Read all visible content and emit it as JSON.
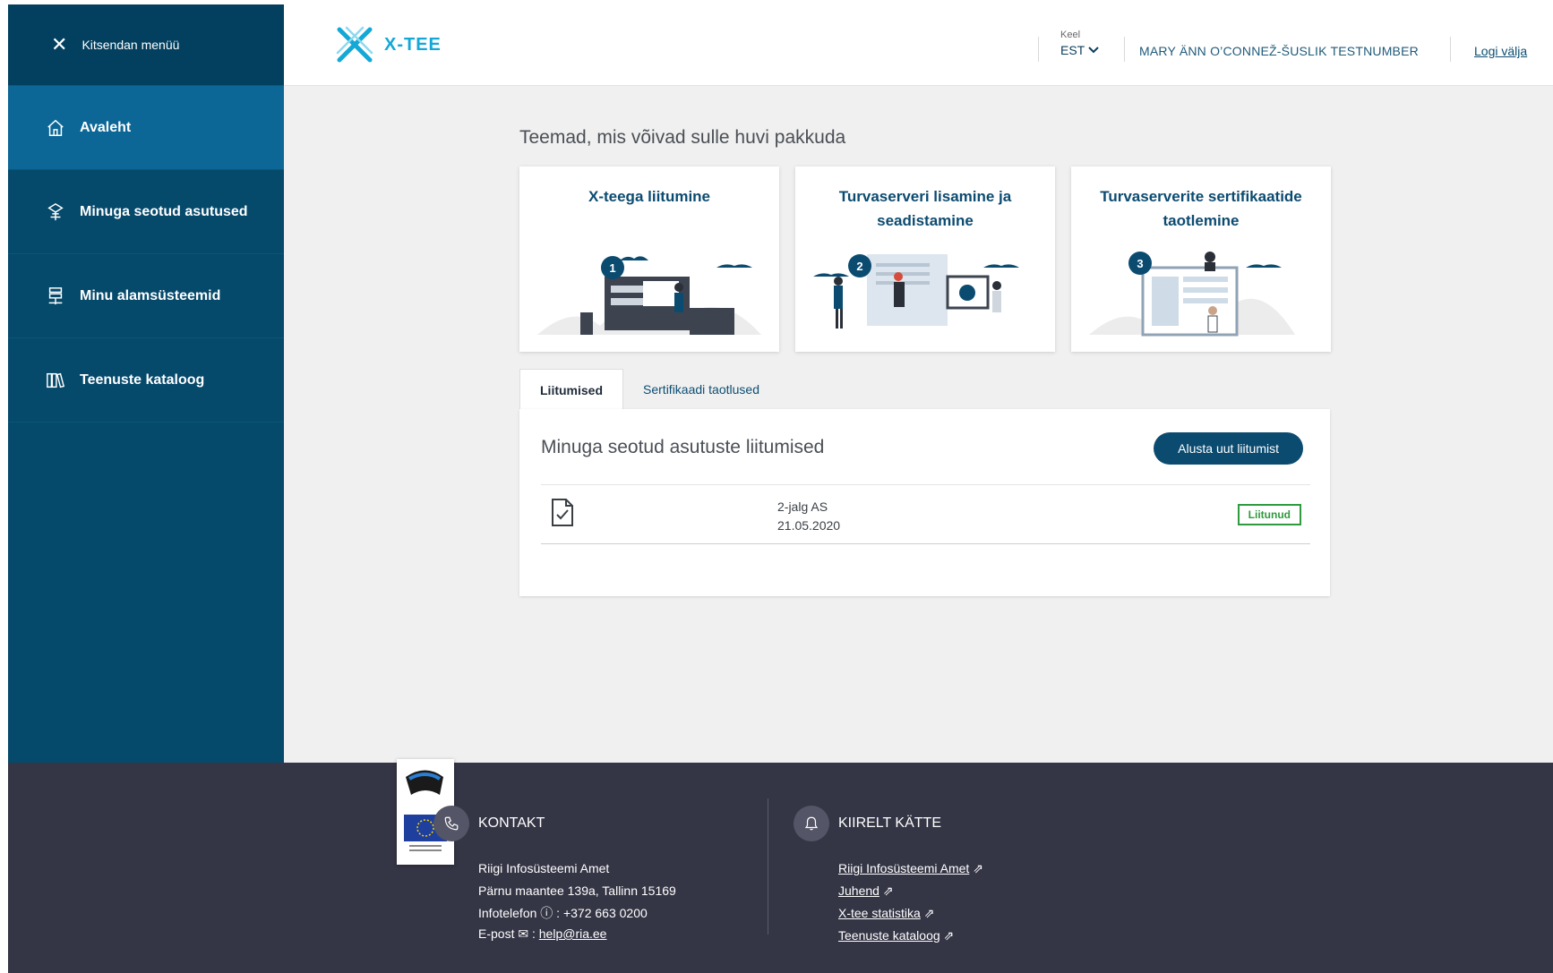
{
  "sidebar": {
    "collapse_label": "Kitsendan menüü",
    "items": [
      {
        "label": "Avaleht",
        "icon": "home-icon",
        "active": true
      },
      {
        "label": "Minuga seotud asutused",
        "icon": "organization-icon",
        "active": false
      },
      {
        "label": "Minu alamsüsteemid",
        "icon": "subsystem-icon",
        "active": false
      },
      {
        "label": "Teenuste kataloog",
        "icon": "catalog-icon",
        "active": false
      }
    ]
  },
  "header": {
    "logo_text": "X-TEE",
    "lang_label": "Keel",
    "lang_value": "EST",
    "user_name": "MARY ÄNN O’CONNEŽ-ŠUSLIK TESTNUMBER",
    "logout_label": "Logi välja"
  },
  "topics": {
    "title": "Teemad, mis võivad sulle huvi pakkuda",
    "cards": [
      {
        "title": "X-teega liitumine",
        "step": "1"
      },
      {
        "title": "Turvaserveri lisamine ja seadistamine",
        "step": "2"
      },
      {
        "title": "Turvaserverite sertifikaatide taotlemine",
        "step": "3"
      }
    ]
  },
  "tabs": [
    {
      "label": "Liitumised",
      "active": true
    },
    {
      "label": "Sertifikaadi taotlused",
      "active": false
    }
  ],
  "panel": {
    "title": "Minuga seotud asutuste liitumised",
    "new_button": "Alusta uut liitumist",
    "rows": [
      {
        "org": "2-jalg AS",
        "date": "21.05.2020",
        "status": "Liitunud"
      }
    ]
  },
  "footer": {
    "contact": {
      "heading": "KONTAKT",
      "org": "Riigi Infosüsteemi Amet",
      "address": "Pärnu maantee 139a, Tallinn 15169",
      "phone_label": "Infotelefon",
      "phone": "+372 663 0200",
      "email_label": "E-post",
      "email": "help@ria.ee"
    },
    "quick": {
      "heading": "KIIRELT KÄTTE",
      "links": [
        "Riigi Infosüsteemi Amet",
        "Juhend",
        "X-tee statistika",
        "Teenuste kataloog"
      ]
    }
  },
  "colors": {
    "sidebar": "#05496b",
    "sidebar_active": "#0c6796",
    "primary": "#0b4b70",
    "accent": "#14a8d6",
    "success": "#2f9a3e",
    "footer": "#343545"
  }
}
